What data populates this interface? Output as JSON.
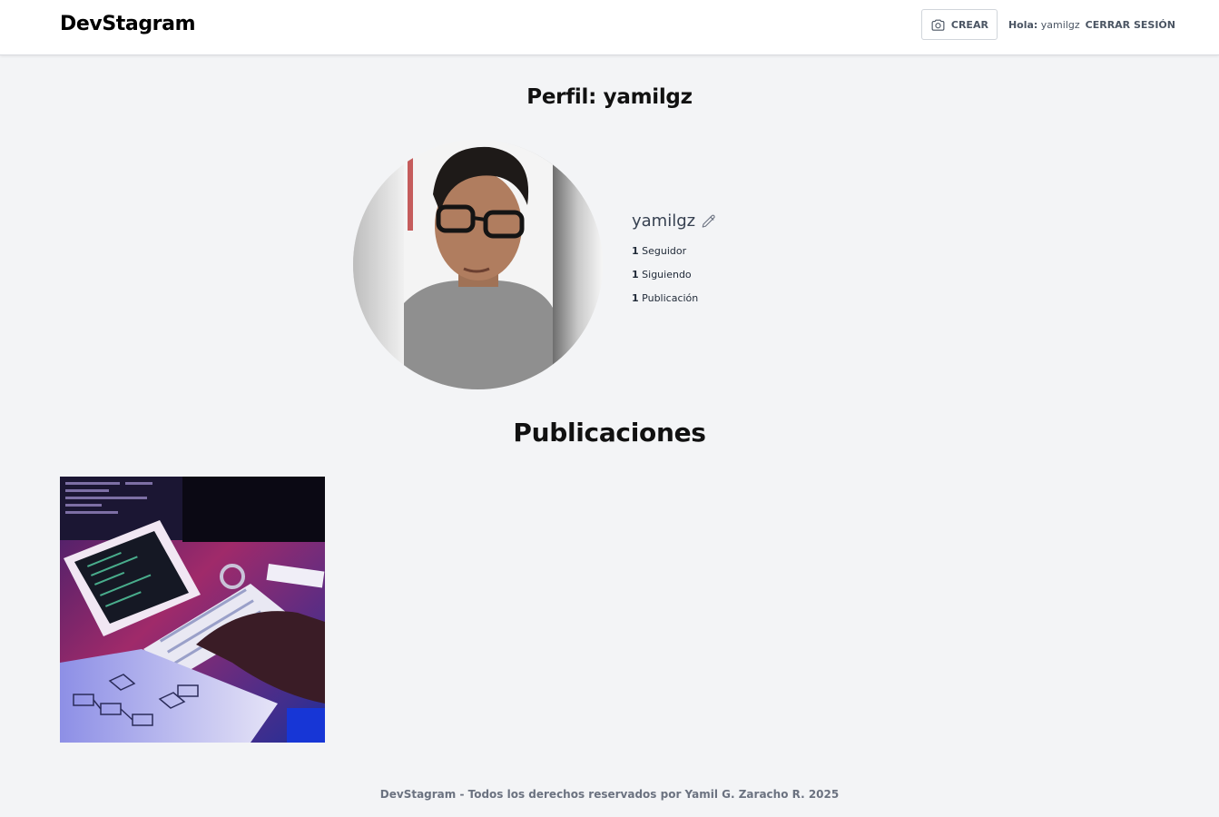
{
  "header": {
    "brand": "DevStagram",
    "create_label": "CREAR",
    "greeting_label": "Hola:",
    "greeting_user": "yamilgz",
    "logout_label": "CERRAR SESIÓN"
  },
  "profile": {
    "title": "Perfil: yamilgz",
    "username": "yamilgz",
    "stats": [
      {
        "count": "1",
        "label": "Seguidor"
      },
      {
        "count": "1",
        "label": "Siguiendo"
      },
      {
        "count": "1",
        "label": "Publicación"
      }
    ]
  },
  "posts": {
    "title": "Publicaciones"
  },
  "footer": {
    "text": "DevStagram - Todos los derechos reservados por Yamil G. Zaracho R. 2025"
  },
  "icons": {
    "camera": "camera-icon",
    "edit": "pencil-icon"
  },
  "colors": {
    "background": "#f3f4f6",
    "header_bg": "#ffffff",
    "muted_text": "#4b5563"
  }
}
